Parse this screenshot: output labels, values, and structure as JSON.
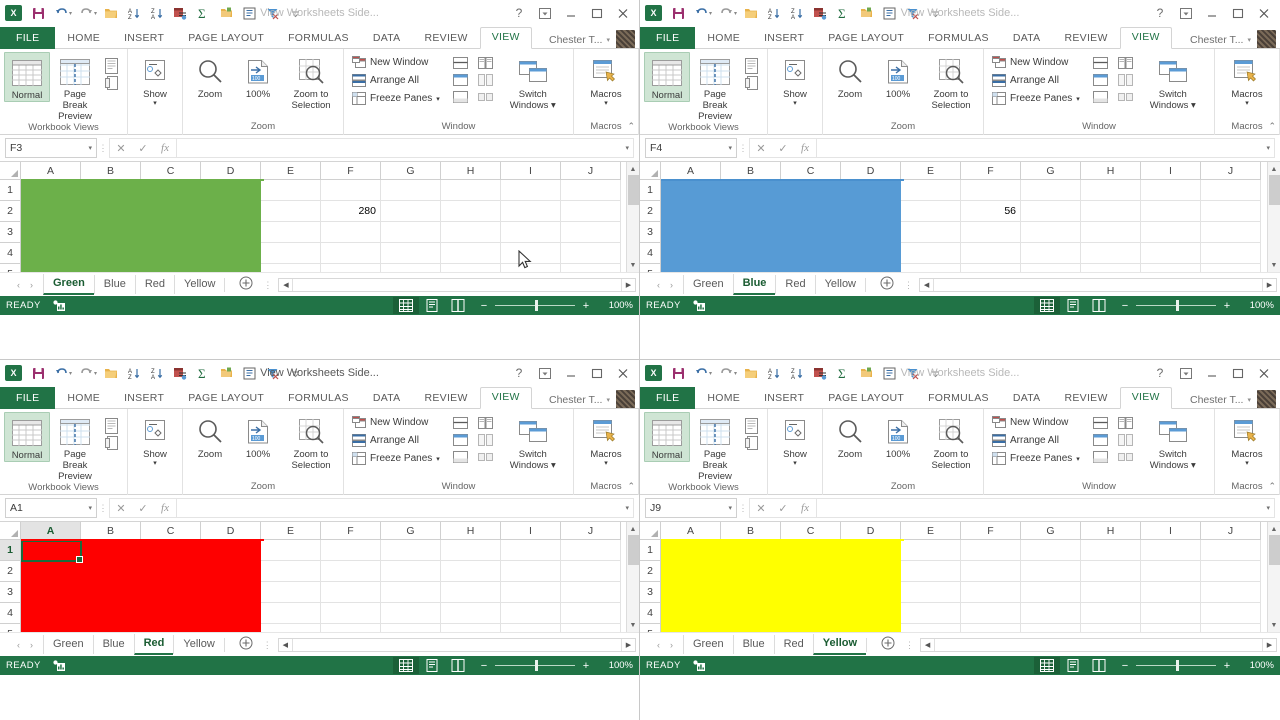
{
  "app": {
    "title": "View Worksheets Side...",
    "title_full": "View Worksheets Side.",
    "logo_text": "X",
    "account_name": "Chester T...",
    "ribbon_tabs": [
      "FILE",
      "HOME",
      "INSERT",
      "PAGE LAYOUT",
      "FORMULAS",
      "DATA",
      "REVIEW",
      "VIEW"
    ],
    "selected_ribbon_tab": "VIEW",
    "qat_icons": [
      "save-icon",
      "undo-icon",
      "redo-icon",
      "open-icon",
      "sort-asc-icon",
      "sort-desc-icon",
      "custom-sort-icon",
      "autosum-icon",
      "new-icon",
      "form-icon",
      "filter-icon",
      "customize-qat-icon"
    ],
    "window_controls": [
      "help-icon",
      "ribbon-display-options-icon",
      "minimize-icon",
      "restore-icon",
      "close-icon"
    ]
  },
  "ribbon": {
    "groups": [
      {
        "name": "Workbook Views",
        "label": "Workbook Views",
        "buttons": [
          {
            "label": "Normal",
            "icon": "normal-view-icon",
            "selected": true
          },
          {
            "label": "Page Break\nPreview",
            "line1": "Page Break",
            "line2": "Preview",
            "icon": "page-break-preview-icon",
            "selected": false
          },
          {
            "label": "",
            "icon": "page-layout-icon",
            "selected": false
          },
          {
            "label": "",
            "icon": "custom-views-icon",
            "selected": false
          }
        ]
      },
      {
        "name": "Show",
        "label": "",
        "buttons": [
          {
            "label": "Show",
            "icon": "show-icon",
            "dropdown": true
          }
        ]
      },
      {
        "name": "Zoom",
        "label": "Zoom",
        "buttons": [
          {
            "label": "Zoom",
            "icon": "zoom-icon"
          },
          {
            "label": "100%",
            "icon": "zoom-100-icon"
          },
          {
            "label": "Zoom to Selection",
            "line1": "Zoom to",
            "line2": "Selection",
            "icon": "zoom-to-selection-icon"
          }
        ]
      },
      {
        "name": "Window",
        "label": "Window",
        "small_buttons": [
          {
            "label": "New Window",
            "icon": "new-window-icon"
          },
          {
            "label": "Arrange All",
            "icon": "arrange-all-icon"
          },
          {
            "label": "Freeze Panes",
            "icon": "freeze-panes-icon",
            "dropdown": true
          }
        ],
        "icon_columns": [
          [
            "split-icon",
            "hide-icon",
            "unhide-icon"
          ],
          [
            "view-side-by-side-icon",
            "synchronous-scrolling-icon",
            "reset-window-position-icon"
          ]
        ],
        "buttons": [
          {
            "label": "Switch Windows",
            "line1": "Switch",
            "line2": "Windows",
            "icon": "switch-windows-icon",
            "dropdown": true
          }
        ]
      },
      {
        "name": "Macros",
        "label": "Macros",
        "buttons": [
          {
            "label": "Macros",
            "icon": "macros-icon",
            "dropdown": true
          }
        ]
      }
    ],
    "collapse_label": "collapse-ribbon-icon"
  },
  "formula_bar": {
    "cancel_icon": "cancel-icon",
    "enter_icon": "enter-icon",
    "function_icon": "insert-function-icon",
    "value": "",
    "expand_icon": "expand-formula-bar-icon"
  },
  "grid": {
    "columns": [
      "A",
      "B",
      "C",
      "D",
      "E",
      "F",
      "G",
      "H",
      "I",
      "J"
    ],
    "rows": [
      "1",
      "2",
      "3",
      "4",
      "5"
    ]
  },
  "sheet_tabs": {
    "names": [
      "Green",
      "Blue",
      "Red",
      "Yellow"
    ],
    "add_label": "+",
    "nav_prev": "‹",
    "nav_next": "›"
  },
  "status_bar": {
    "state": "READY",
    "macro_icon": "record-macro-icon",
    "view_buttons": [
      "normal-view-icon",
      "page-layout-view-icon",
      "page-break-preview-icon"
    ],
    "zoom_minus": "−",
    "zoom_plus": "+",
    "zoom_level": "100%"
  },
  "colors": {
    "excel_green": "#217346",
    "fill_green": "#6CB04A",
    "fill_blue": "#579BD5",
    "fill_red": "#FE0000",
    "fill_yellow": "#FFFF00",
    "header_line_green": "#6CB04A",
    "header_line_blue": "#4A90CE",
    "header_line_red": "#FE0000",
    "header_line_yellow": "#FFFF00"
  },
  "windows": [
    {
      "id": "green-window",
      "active": false,
      "name_box": "F3",
      "active_sheet": "Green",
      "fill_color": "#6CB04A",
      "header_line_color": "#6CB04A",
      "fill_range": "A1:D5",
      "cell_values": [
        {
          "ref": "F2",
          "row": 2,
          "col": "F",
          "value": "280"
        }
      ],
      "show_active_cell": false,
      "show_cursor": true
    },
    {
      "id": "blue-window",
      "active": false,
      "name_box": "F4",
      "active_sheet": "Blue",
      "fill_color": "#579BD5",
      "header_line_color": "#4A90CE",
      "fill_range": "A1:D5",
      "cell_values": [
        {
          "ref": "F2",
          "row": 2,
          "col": "F",
          "value": "56"
        }
      ],
      "show_active_cell": false,
      "show_cursor": false
    },
    {
      "id": "red-window",
      "active": true,
      "name_box": "A1",
      "active_sheet": "Red",
      "fill_color": "#FE0000",
      "header_line_color": "#FE0000",
      "fill_range": "A1:D5",
      "cell_values": [],
      "show_active_cell": true,
      "show_cursor": false
    },
    {
      "id": "yellow-window",
      "active": false,
      "name_box": "J9",
      "active_sheet": "Yellow",
      "fill_color": "#FFFF00",
      "header_line_color": "#FFFF00",
      "fill_range": "A1:D5",
      "cell_values": [],
      "show_active_cell": false,
      "show_cursor": false
    }
  ]
}
